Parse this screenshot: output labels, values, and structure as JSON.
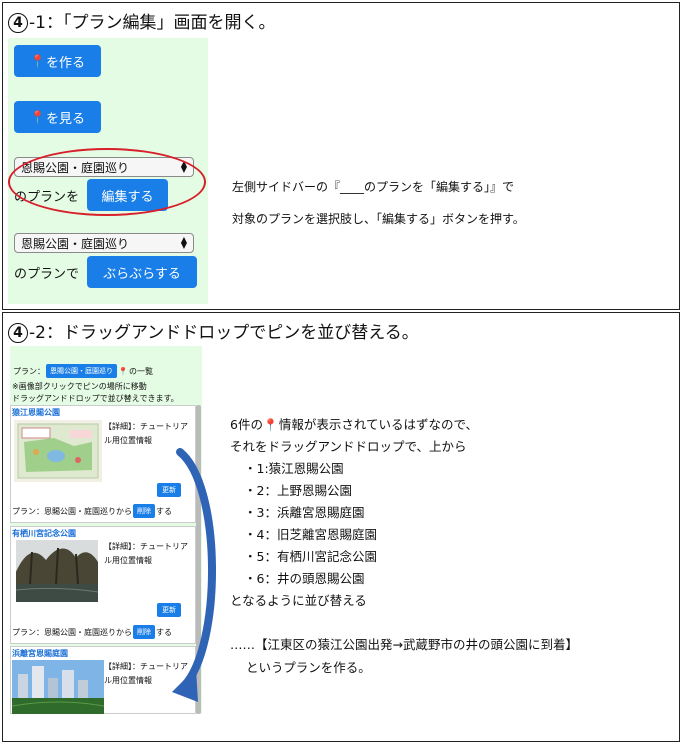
{
  "section1": {
    "number": "4",
    "title": "-1：「プラン編集」画面を開く。",
    "buttons": {
      "make": "を作る",
      "view": "を見る",
      "edit": "編集する",
      "stroll": "ぶらぶらする"
    },
    "select_value": "恩賜公園・庭園巡り",
    "label_edit": "のプランを",
    "label_stroll": "のプランで",
    "desc_line1": "左側サイドバーの『____のプランを「編集する」』で",
    "desc_line2": "対象のプランを選択肢し、「編集する」ボタンを押す。"
  },
  "section2": {
    "number": "4",
    "title": "-2：ドラッグアンドドロップでピンを並び替える。",
    "panel": {
      "plan_prefix": "プラン：",
      "plan_button": "恩賜公園・庭園巡り",
      "plan_suffix": "の一覧",
      "note1": "※画像部クリックでピンの場所に移動",
      "note2": "ドラッグアンドドロップで並び替えできます。",
      "cards": [
        {
          "title": "猿江恩賜公園",
          "detail": "【詳細】：チュートリアル用位置情報",
          "update": "更新",
          "plan_label": "プラン：恩賜公園・庭園巡りから",
          "delete": "削除",
          "suffix": "する"
        },
        {
          "title": "有栖川宮記念公園",
          "detail": "【詳細】：チュートリアル用位置情報",
          "update": "更新",
          "plan_label": "プラン：恩賜公園・庭園巡りから",
          "delete": "削除",
          "suffix": "する"
        },
        {
          "title": "浜離宮恩賜庭園",
          "detail": "【詳細】：チュートリアル用位置情報"
        }
      ]
    },
    "text_intro_pre": "6件の",
    "text_intro_post": "情報が表示されているはずなので、",
    "text_line2": "それをドラッグアンドドロップで、上から",
    "list": [
      "・1:猿江恩賜公園",
      "・2：上野恩賜公園",
      "・3：浜離宮恩賜庭園",
      "・4：旧芝離宮恩賜庭園",
      "・5：有栖川宮記念公園",
      "・6：井の頭恩賜公園"
    ],
    "text_after": "となるように並び替える",
    "summary1": "……【江東区の猿江公園出発→武蔵野市の井の頭公園に到着】",
    "summary2": "というプランを作る。"
  },
  "colors": {
    "button": "#1a7ee8",
    "panel": "#e4fbe4",
    "ellipse": "#d8202a",
    "arrow": "#2f63b5",
    "pin": "#e8332b"
  },
  "icons": {
    "pin": "map-pin-icon",
    "select": "select-arrows-icon"
  }
}
